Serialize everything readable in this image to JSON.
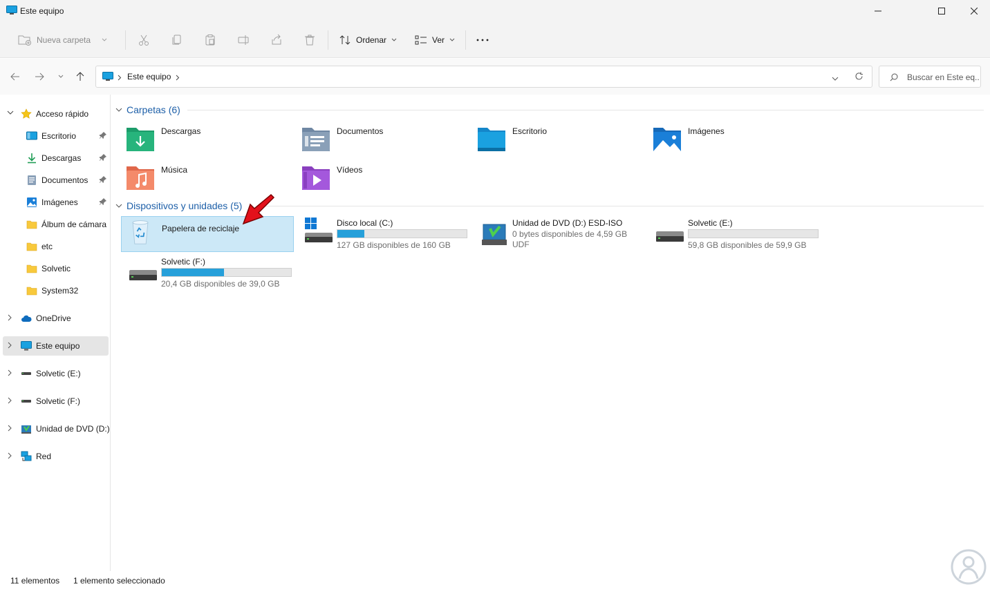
{
  "window": {
    "title": "Este equipo"
  },
  "toolbar": {
    "new_folder_label": "Nueva carpeta",
    "sort_label": "Ordenar",
    "view_label": "Ver",
    "more_label": "···"
  },
  "address": {
    "crumbs": [
      "Este equipo"
    ],
    "search_placeholder": "Buscar en Este eq..."
  },
  "sidebar": {
    "quick_access": "Acceso rápido",
    "quick_items": [
      {
        "label": "Escritorio",
        "icon": "desktop-icon",
        "pinned": true
      },
      {
        "label": "Descargas",
        "icon": "download-icon",
        "pinned": true
      },
      {
        "label": "Documentos",
        "icon": "document-icon",
        "pinned": true
      },
      {
        "label": "Imágenes",
        "icon": "pictures-icon",
        "pinned": true
      },
      {
        "label": "Álbum de cámara",
        "icon": "folder-icon",
        "pinned": false
      },
      {
        "label": "etc",
        "icon": "folder-icon",
        "pinned": false
      },
      {
        "label": "Solvetic",
        "icon": "folder-icon",
        "pinned": false
      },
      {
        "label": "System32",
        "icon": "folder-icon",
        "pinned": false
      }
    ],
    "onedrive": "OneDrive",
    "this_pc": "Este equipo",
    "drive_e": "Solvetic (E:)",
    "drive_f": "Solvetic (F:)",
    "dvd": "Unidad de DVD (D:)",
    "network": "Red"
  },
  "folders": {
    "header": "Carpetas (6)",
    "items": [
      "Descargas",
      "Documentos",
      "Escritorio",
      "Imágenes",
      "Música",
      "Vídeos"
    ]
  },
  "devices": {
    "header": "Dispositivos y unidades (5)",
    "recycle_bin": "Papelera de reciclaje",
    "drives": [
      {
        "name": "Disco local (C:)",
        "info": "127 GB disponibles de 160 GB",
        "used_fraction": 0.21
      },
      {
        "name": "Unidad de DVD (D:) ESD-ISO",
        "info": "0 bytes disponibles de 4,59 GB",
        "info2": "UDF"
      },
      {
        "name": "Solvetic (E:)",
        "info": "59,8 GB disponibles de 59,9 GB",
        "used_fraction": 0.0
      },
      {
        "name": "Solvetic (F:)",
        "info": "20,4 GB disponibles de 39,0 GB",
        "used_fraction": 0.48
      }
    ]
  },
  "status": {
    "count": "11 elementos",
    "selected": "1 elemento seleccionado"
  },
  "colors": {
    "accent": "#1d5fa8",
    "selection": "#cce8f7",
    "drive_fill": "#26a0da"
  }
}
